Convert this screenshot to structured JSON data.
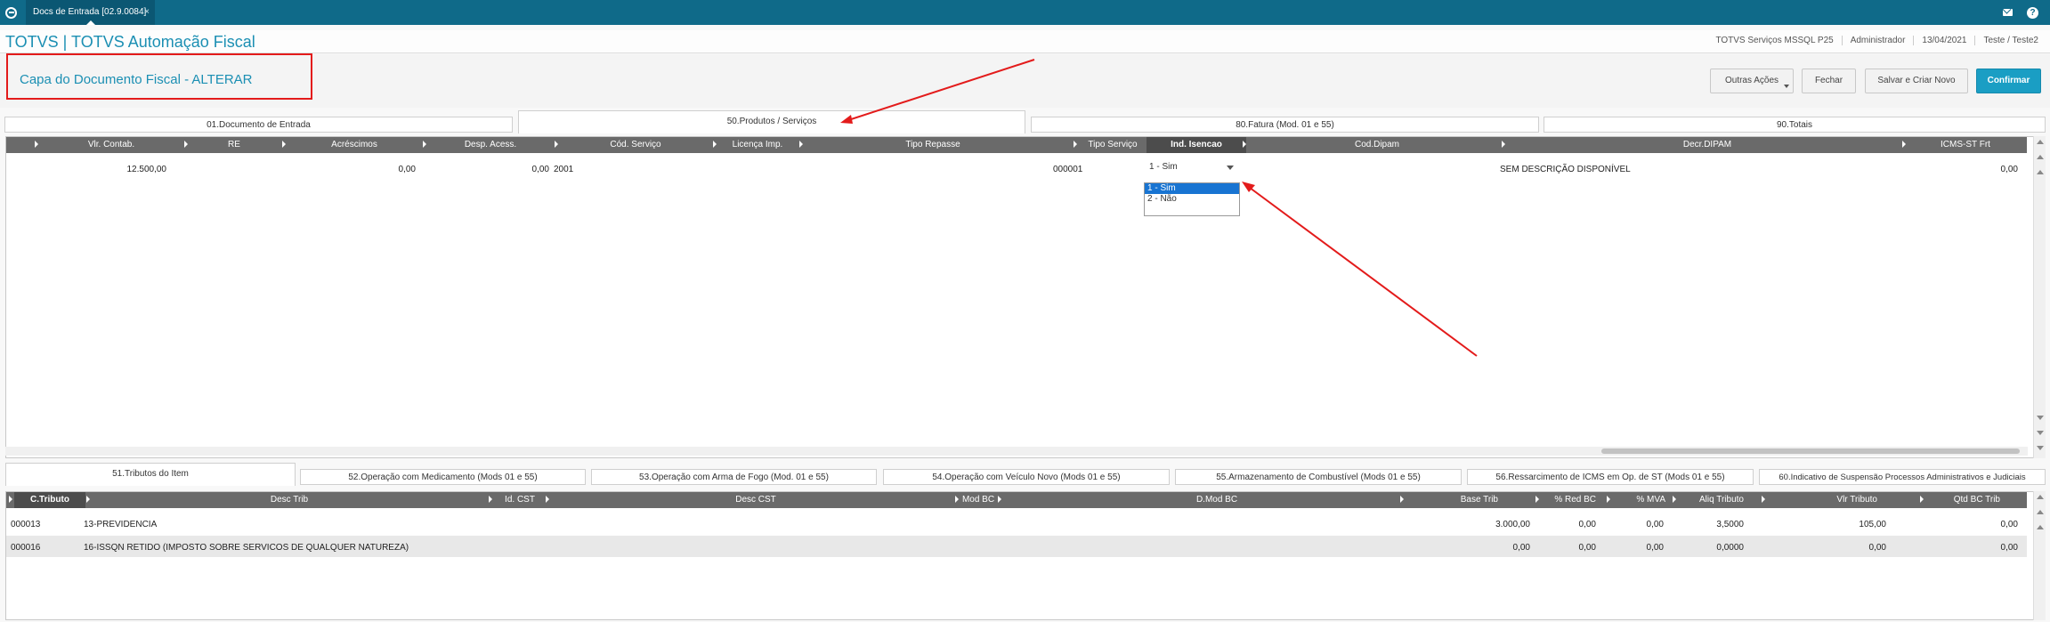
{
  "topbar": {
    "tab_label": "Docs de Entrada [02.9.0084]",
    "tab_close": "×",
    "help": "?"
  },
  "app": {
    "title": "TOTVS | TOTVS Automação Fiscal",
    "server": "TOTVS Serviços MSSQL P25",
    "user": "Administrador",
    "date": "13/04/2021",
    "env": "Teste / Teste2"
  },
  "page": {
    "title": "Capa do Documento Fiscal - ALTERAR"
  },
  "actions": {
    "other": "Outras Ações",
    "close": "Fechar",
    "save_new": "Salvar e Criar Novo",
    "confirm": "Confirmar"
  },
  "tabs_top": [
    "01.Documento de Entrada",
    "50.Produtos / Serviços",
    "80.Fatura (Mod. 01 e 55)",
    "90.Totais"
  ],
  "grid1": {
    "headers": [
      "Vlr. Contab.",
      "RE",
      "Acréscimos",
      "Desp. Acess.",
      "Cód. Serviço",
      "Licença Imp.",
      "Tipo Repasse",
      "Tipo Serviço",
      "Ind. Isencao",
      "Cod.Dipam",
      "Decr.DIPAM",
      "ICMS-ST Frt"
    ],
    "row": {
      "vlr_contab": "12.500,00",
      "acrescimos": "0,00",
      "desp_acess": "0,00",
      "cod_servico": "2001",
      "tipo_servico": "000001",
      "ind_isencao": "1 - Sim",
      "decr_dipam": "SEM DESCRIÇÃO DISPONÍVEL",
      "icms_st_frt": "0,00"
    },
    "dropdown_options": [
      "1 - Sim",
      "2 - Não"
    ]
  },
  "tabs_bottom": [
    "51.Tributos do Item",
    "52.Operação com Medicamento (Mods 01 e 55)",
    "53.Operação com Arma de Fogo (Mod. 01 e 55)",
    "54.Operação com Veículo Novo (Mods 01 e 55)",
    "55.Armazenamento de Combustível (Mods 01 e 55)",
    "56.Ressarcimento de ICMS em Op. de ST (Mods 01 e 55)",
    "60.Indicativo de Suspensão Processos Administrativos e Judiciais"
  ],
  "grid2": {
    "headers": [
      "C.Tributo",
      "Desc Trib",
      "Id. CST",
      "Desc CST",
      "Mod BC",
      "D.Mod BC",
      "Base Trib",
      "% Red BC",
      "% MVA",
      "Aliq Tributo",
      "Vlr Tributo",
      "Qtd BC Trib"
    ],
    "rows": [
      {
        "codigo": "000013",
        "desc": "13-PREVIDENCIA",
        "base": "3.000,00",
        "red_bc": "0,00",
        "mva": "0,00",
        "aliq": "3,5000",
        "vlr": "105,00",
        "qtd": "0,00"
      },
      {
        "codigo": "000016",
        "desc": "16-ISSQN RETIDO (IMPOSTO SOBRE SERVICOS DE QUALQUER NATUREZA)",
        "base": "0,00",
        "red_bc": "0,00",
        "mva": "0,00",
        "aliq": "0,0000",
        "vlr": "0,00",
        "qtd": "0,00"
      }
    ]
  },
  "colors": {
    "topbar": "#0f6a89",
    "accent": "#1b8fb3",
    "confirm": "#1a9ec4",
    "annotation": "#e31b1b"
  }
}
